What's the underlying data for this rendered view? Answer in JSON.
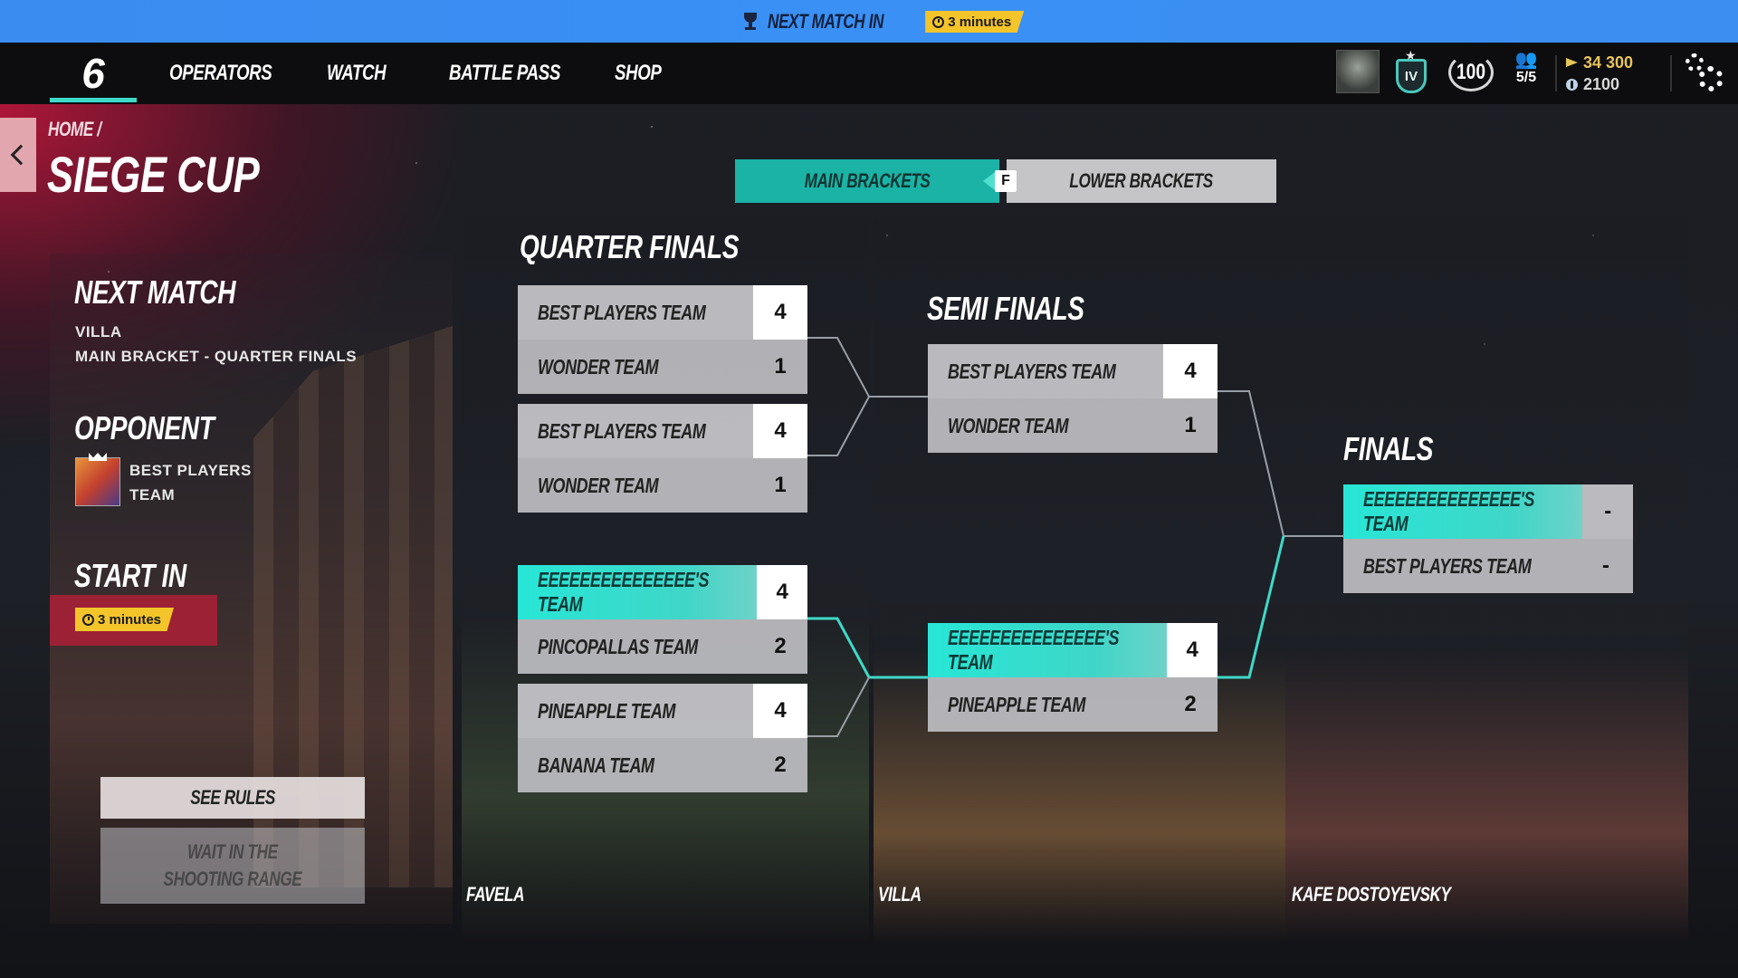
{
  "banner": {
    "text": "NEXT MATCH IN",
    "timer": "3 minutes"
  },
  "nav": {
    "logo": "6",
    "items": [
      "OPERATORS",
      "WATCH",
      "BATTLE PASS",
      "SHOP"
    ]
  },
  "profile": {
    "rank_label": "IV",
    "level": "100",
    "squad": "5/5",
    "renown": "34 300",
    "credits": "2100"
  },
  "page": {
    "breadcrumb": "HOME /",
    "title": "SIEGE CUP"
  },
  "tabs": {
    "active": "MAIN BRACKETS",
    "inactive": "LOWER BRACKETS",
    "key_hint": "F"
  },
  "next_match": {
    "heading": "NEXT MATCH",
    "map": "VILLA",
    "stage": "MAIN BRACKET - QUARTER FINALS",
    "opponent_heading": "OPPONENT",
    "opponent_line1": "BEST PLAYERS",
    "opponent_line2": "TEAM",
    "start_heading": "START IN",
    "start_timer": "3 minutes",
    "see_rules": "SEE RULES",
    "range_line1": "WAIT IN THE",
    "range_line2": "SHOOTING RANGE"
  },
  "columns": {
    "quarter": {
      "title": "QUARTER FINALS",
      "map": "FAVELA"
    },
    "semi": {
      "title": "SEMI FINALS",
      "map": "VILLA"
    },
    "finals": {
      "title": "FINALS",
      "map": "KAFE DOSTOYEVSKY"
    }
  },
  "bracket": {
    "quarter": [
      {
        "top": {
          "name": "BEST PLAYERS TEAM",
          "score": "4",
          "win": true
        },
        "bottom": {
          "name": "WONDER TEAM",
          "score": "1"
        }
      },
      {
        "top": {
          "name": "BEST PLAYERS TEAM",
          "score": "4",
          "win": true
        },
        "bottom": {
          "name": "WONDER TEAM",
          "score": "1"
        }
      },
      {
        "top": {
          "name": "EEEEEEEEEEEEEEE'S TEAM",
          "score": "4",
          "win": true,
          "highlight": true
        },
        "bottom": {
          "name": "PINCOPALLAS TEAM",
          "score": "2"
        }
      },
      {
        "top": {
          "name": "PINEAPPLE TEAM",
          "score": "4",
          "win": true
        },
        "bottom": {
          "name": "BANANA TEAM",
          "score": "2"
        }
      }
    ],
    "semi": [
      {
        "top": {
          "name": "BEST PLAYERS TEAM",
          "score": "4",
          "win": true
        },
        "bottom": {
          "name": "WONDER TEAM",
          "score": "1"
        }
      },
      {
        "top": {
          "name": "EEEEEEEEEEEEEEE'S TEAM",
          "score": "4",
          "win": true,
          "highlight": true
        },
        "bottom": {
          "name": "PINEAPPLE TEAM",
          "score": "2"
        }
      }
    ],
    "final": [
      {
        "top": {
          "name": "EEEEEEEEEEEEEEE'S TEAM",
          "score": "-",
          "highlight": true
        },
        "bottom": {
          "name": "BEST PLAYERS TEAM",
          "score": "-"
        }
      }
    ]
  },
  "colors": {
    "accent": "#3fd9c8",
    "banner": "#3a8cf0",
    "timer": "#f4c52a",
    "card": "#c8c8cc"
  }
}
